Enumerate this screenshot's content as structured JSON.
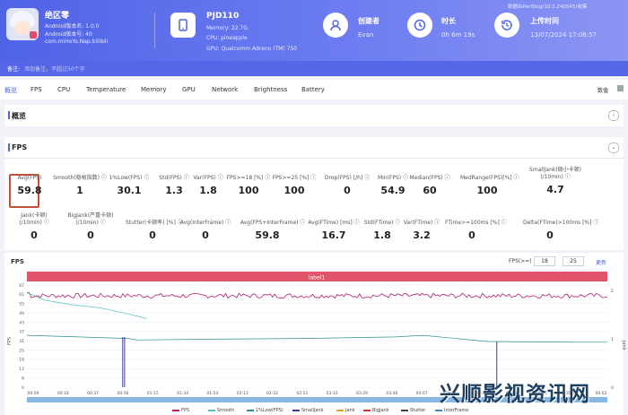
{
  "user": {
    "name": "绝区零",
    "line1": "Android版本名: 1.0.0",
    "line2": "Android版本号: 40",
    "package": "com.miHoYo.Nap.bilibili"
  },
  "device": {
    "model": "PJD110",
    "memory": "Memory: 22.7G",
    "cpu": "CPU: pineapple",
    "gpu": "GPU: Qualcomm Adreno (TM) 750"
  },
  "creator": {
    "title": "创建者",
    "value": "Evan"
  },
  "duration": {
    "title": "时长",
    "value": "0h 6m 19s"
  },
  "upload": {
    "title": "上传时间",
    "value": "13/07/2024 17:08:57"
  },
  "data_source": "数据由PerfDog(10.3.240545)收集",
  "notes": {
    "label": "备注:",
    "placeholder": "添加备注，不超过50个字"
  },
  "tabs": [
    "概览",
    "FPS",
    "CPU",
    "Temperature",
    "Memory",
    "GPU",
    "Network",
    "Brightness",
    "Battery"
  ],
  "tabs_right": "数值",
  "overview_title": "概览",
  "fps_title": "FPS",
  "metrics_row1": [
    {
      "label": "Avg(FPS)",
      "value": "59.8"
    },
    {
      "label": "Smooth(稳帧指数) ⓘ",
      "value": "1"
    },
    {
      "label": "1%Low(FPS) ⓘ",
      "value": "30.1"
    },
    {
      "label": "Std(FPS) ⓘ",
      "value": "1.3"
    },
    {
      "label": "Var(FPS) ⓘ",
      "value": "1.8"
    },
    {
      "label": "FPS>=18 [%] ⓘ",
      "value": "100"
    },
    {
      "label": "FPS>=25 [%] ⓘ",
      "value": "100"
    },
    {
      "label": "Drop(FPS) [/h] ⓘ",
      "value": "0"
    },
    {
      "label": "Min(FPS) ⓘ",
      "value": "54.9"
    },
    {
      "label": "Median(FPS) ⓘ",
      "value": "60"
    },
    {
      "label": "MedRange(FPS)[%] ⓘ",
      "value": "100"
    },
    {
      "label": "SmallJank(微小卡顿)\n(/10min) ⓘ",
      "value": "4.7"
    }
  ],
  "metrics_row2": [
    {
      "label": "Jank(卡顿)\n(/10min) ⓘ",
      "value": "0"
    },
    {
      "label": "BigJank(严重卡顿)\n(/10min) ⓘ",
      "value": "0"
    },
    {
      "label": "Stutter(卡顿率) [%] ⓘ",
      "value": "0"
    },
    {
      "label": "Avg(InterFrame) ⓘ",
      "value": "0"
    },
    {
      "label": "Avg(FPS+InterFrame) ⓘ",
      "value": "59.8"
    },
    {
      "label": "Avg(FTime) [ms] ⓘ",
      "value": "16.7"
    },
    {
      "label": "Std(FTime) ⓘ",
      "value": "1.8"
    },
    {
      "label": "Var(FTime) ⓘ",
      "value": "3.2"
    },
    {
      "label": "FTime>=100ms [%] ⓘ",
      "value": "0"
    },
    {
      "label": "Delta(FTime)>100ms [%] ⓘ",
      "value": "0"
    }
  ],
  "chart": {
    "title": "FPS",
    "threshold_label": "FPS(>=)",
    "threshold_values": [
      "18",
      "25"
    ],
    "apply_label": "更新",
    "band_label": "label1",
    "y_axis_label": "FPS",
    "y2_axis_label": "Jank"
  },
  "chart_data": {
    "type": "line",
    "ylim": [
      0,
      67
    ],
    "y2lim": [
      0,
      2
    ],
    "y_ticks": [
      "67",
      "61",
      "55",
      "49",
      "43",
      "37",
      "31",
      "25",
      "18",
      "12",
      "6",
      "0"
    ],
    "y2_ticks": [
      "2",
      "1",
      "0"
    ],
    "x_ticks": [
      "00:00",
      "00:18",
      "00:37",
      "00:56",
      "01:15",
      "01:34",
      "01:54",
      "02:13",
      "02:32",
      "02:51",
      "03:10",
      "03:29",
      "03:48",
      "04:07",
      "04:26",
      "04:45",
      "05:04",
      "05:24",
      "05:43",
      "06:02"
    ],
    "series": [
      {
        "name": "FPS",
        "color": "#b0206a",
        "x": [
          0,
          0.1,
          0.3,
          0.6,
          1,
          1.5,
          2,
          2.5,
          3,
          3.5,
          4,
          4.5,
          5,
          5.5,
          6,
          6.3
        ],
        "y": [
          62,
          61,
          59,
          61,
          60,
          61,
          59,
          60,
          61,
          60,
          59,
          60,
          61,
          60,
          58,
          60
        ]
      },
      {
        "name": "Smooth",
        "color": "#57c0c4",
        "x": [
          0,
          0.2,
          0.5,
          0.8,
          1.1,
          1.3
        ],
        "y": [
          62,
          57,
          54,
          52,
          48,
          45
        ]
      },
      {
        "name": "1%Low(FPS)",
        "color": "#2c8f8f",
        "x": [
          0,
          1.1,
          1.2,
          2,
          3,
          4,
          4.3,
          5,
          6,
          6.3
        ],
        "y": [
          34,
          32,
          31,
          31.5,
          32,
          33,
          34,
          30,
          29.5,
          29.5
        ]
      }
    ],
    "jank_markers_x": [
      "01:04",
      "01:06",
      "05:06"
    ]
  },
  "legend": [
    {
      "name": "FPS",
      "color": "#b0206a"
    },
    {
      "name": "Smooth",
      "color": "#57c0c4"
    },
    {
      "name": "1%Low(FPS)",
      "color": "#2c8f8f"
    },
    {
      "name": "SmallJank",
      "color": "#3b3ba8"
    },
    {
      "name": "Jank",
      "color": "#e0a030"
    },
    {
      "name": "BigJank",
      "color": "#cc3333"
    },
    {
      "name": "Stutter",
      "color": "#444444"
    },
    {
      "name": "InterFrame",
      "color": "#3a8ec8"
    }
  ],
  "watermark": "兴顺影视资讯网",
  "accent": "#4f63e6"
}
